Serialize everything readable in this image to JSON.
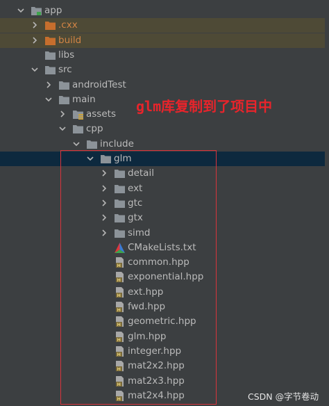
{
  "tree": [
    {
      "label": "app",
      "indent": 0,
      "expanded": true,
      "type": "module",
      "style": "blue"
    },
    {
      "label": ".cxx",
      "indent": 1,
      "expanded": false,
      "type": "folder-orange",
      "style": "orange",
      "excluded": true
    },
    {
      "label": "build",
      "indent": 1,
      "expanded": false,
      "type": "folder-orange",
      "style": "orange",
      "excluded": true
    },
    {
      "label": "libs",
      "indent": 1,
      "type": "folder"
    },
    {
      "label": "src",
      "indent": 1,
      "expanded": true,
      "type": "folder"
    },
    {
      "label": "androidTest",
      "indent": 2,
      "expanded": false,
      "type": "folder"
    },
    {
      "label": "main",
      "indent": 2,
      "expanded": true,
      "type": "folder"
    },
    {
      "label": "assets",
      "indent": 3,
      "expanded": false,
      "type": "folder-assets"
    },
    {
      "label": "cpp",
      "indent": 3,
      "expanded": true,
      "type": "folder"
    },
    {
      "label": "include",
      "indent": 4,
      "expanded": true,
      "type": "folder"
    },
    {
      "label": "glm",
      "indent": 5,
      "expanded": true,
      "type": "folder",
      "selected": true
    },
    {
      "label": "detail",
      "indent": 6,
      "expanded": false,
      "type": "folder"
    },
    {
      "label": "ext",
      "indent": 6,
      "expanded": false,
      "type": "folder"
    },
    {
      "label": "gtc",
      "indent": 6,
      "expanded": false,
      "type": "folder"
    },
    {
      "label": "gtx",
      "indent": 6,
      "expanded": false,
      "type": "folder"
    },
    {
      "label": "simd",
      "indent": 6,
      "expanded": false,
      "type": "folder"
    },
    {
      "label": "CMakeLists.txt",
      "indent": 6,
      "type": "cmake"
    },
    {
      "label": "common.hpp",
      "indent": 6,
      "type": "hpp"
    },
    {
      "label": "exponential.hpp",
      "indent": 6,
      "type": "hpp"
    },
    {
      "label": "ext.hpp",
      "indent": 6,
      "type": "hpp"
    },
    {
      "label": "fwd.hpp",
      "indent": 6,
      "type": "hpp"
    },
    {
      "label": "geometric.hpp",
      "indent": 6,
      "type": "hpp"
    },
    {
      "label": "glm.hpp",
      "indent": 6,
      "type": "hpp"
    },
    {
      "label": "integer.hpp",
      "indent": 6,
      "type": "hpp"
    },
    {
      "label": "mat2x2.hpp",
      "indent": 6,
      "type": "hpp"
    },
    {
      "label": "mat2x3.hpp",
      "indent": 6,
      "type": "hpp"
    },
    {
      "label": "mat2x4.hpp",
      "indent": 6,
      "type": "hpp"
    }
  ],
  "annotation": "glm库复制到了项目中",
  "watermark": "CSDN @字节卷动",
  "colors": {
    "background": "#3c3f41",
    "selected_row": "#0d293e",
    "excluded_row": "#4e4a36",
    "folder": "#8c9399",
    "folder_orange": "#c66e2d",
    "annotation": "#e8242b",
    "highlight_box": "#d9343c"
  }
}
